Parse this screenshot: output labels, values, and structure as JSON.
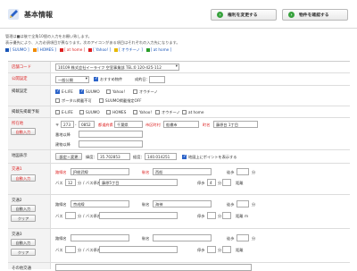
{
  "header": {
    "title": "基本情報",
    "btn_change": "権利を変更する",
    "btn_confirm": "物件を確認する"
  },
  "notes": [
    "管理は■は後で全角10個の入力をお願い致します。",
    "表示優先により、入力必須項目が異なります。次のアイコンがある項目はそれぞれの入力先になります。"
  ],
  "legend": [
    {
      "label": "[ SUUMO ]",
      "color": "#1a56b8"
    },
    {
      "label": "[ HOMES ]",
      "color": "#1a56b8"
    },
    {
      "label": "[ at home ]",
      "color": "#d22"
    },
    {
      "label": "[ Yahoo! ]",
      "color": "#1a56b8"
    },
    {
      "label": "[ オウチーノ ]",
      "color": "#1a56b8"
    },
    {
      "label": "[ at home ]",
      "color": "#1a56b8"
    }
  ],
  "rows": {
    "shop_code": {
      "label": "店舗コード",
      "value": "10109 株式会社イーライフ 空室事業部 TEL:0 120-425-112"
    },
    "public": {
      "label": "公開設定",
      "select": "一般公開",
      "check_label": "おすすめ物件",
      "rank_label": "成約日："
    },
    "posting": {
      "label": "掲載設定",
      "sites": [
        "E-LIFE",
        "SUUMO",
        "Yahoo!",
        "オウチーノ"
      ],
      "sub": [
        "ポータル掲載不可",
        "SUUMO掲載指定OFF"
      ]
    },
    "posted": {
      "label": "掲載先掲載予報",
      "sites": [
        "E-LIFE",
        "SUUMO",
        "HOMES",
        "Yahoo!",
        "オウチーノ",
        "at home"
      ]
    },
    "address": {
      "label": "所在地",
      "btn": "自動入力",
      "zip_prefix": "〒",
      "zip1": "273",
      "zip2": "0852",
      "pref_label": "都道府県",
      "pref": "千葉県",
      "city_label": "市区町村",
      "city": "船橋市",
      "town_label": "町名",
      "town": "藤原台 1丁目",
      "extra1": "番地以降",
      "extra2": "建物以降"
    },
    "map": {
      "label": "地図表示",
      "btn": "設定・変更",
      "lat_label": "緯度：",
      "lat": "35.702853",
      "lng_label": "経度：",
      "lng": "140.014251",
      "pin_label": "地図上にポイントを表示する"
    },
    "transport1": {
      "label": "交通1",
      "btn": "自動入力",
      "line_label": "路線名",
      "line": "JR総武線",
      "station_label": "駅名",
      "station": "西船",
      "walk_label": "徒歩",
      "walk_unit": "分",
      "bus_label": "バス",
      "bus": "12",
      "bus_unit": "分",
      "bus_stop_label": "バス停名",
      "bus_stop": "藤原5丁目",
      "stop_walk_label": "停歩",
      "stop_walk": "4",
      "stop_walk_unit": "分",
      "dist_label": "距離"
    },
    "transport2": {
      "label": "交通2",
      "btn1": "自動入力",
      "btn2": "クリア",
      "line_label": "路線名",
      "line": "京成線",
      "station_label": "駅名",
      "station": "海神",
      "walk_label": "徒歩",
      "walk_unit": "分",
      "bus_label": "バス",
      "bus_unit": "分",
      "bus_stop_label": "バス停名",
      "stop_walk_label": "停歩",
      "stop_walk_unit": "分",
      "dist_label": "距離",
      "dist_unit": "m"
    },
    "transport3": {
      "label": "交通3",
      "btn1": "自動入力",
      "btn2": "クリア",
      "line_label": "路線名",
      "station_label": "駅名",
      "walk_label": "徒歩",
      "walk_unit": "分",
      "bus_label": "バス",
      "bus_unit": "分",
      "bus_stop_label": "バス停名",
      "stop_walk_label": "停歩",
      "stop_walk_unit": "分",
      "dist_label": "距離"
    },
    "other": {
      "label": "その他交通"
    }
  },
  "colors": {
    "accent": "#37a23d",
    "required": "#dd2222",
    "link": "#1a56b8"
  }
}
